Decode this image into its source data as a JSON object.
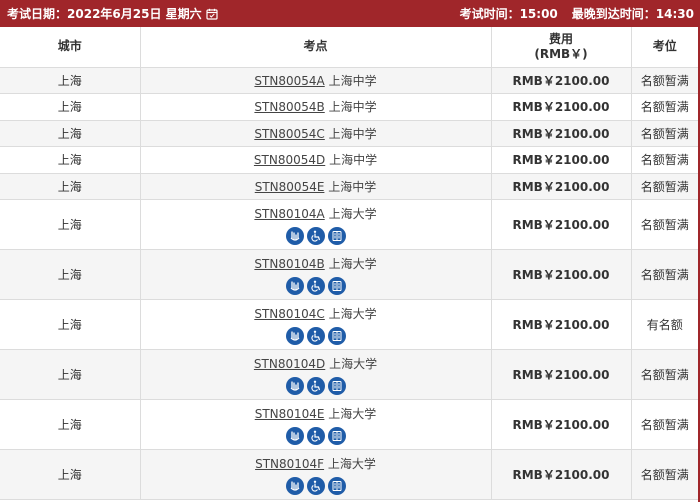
{
  "header": {
    "date_label": "考试日期：",
    "date_value": "2022年6月25日 星期六",
    "time_label": "考试时间：",
    "time_value": "15:00",
    "arrive_label": "最晚到达时间：",
    "arrive_value": "14:30"
  },
  "table": {
    "columns": [
      "城市",
      "考点",
      "费用",
      "(RMB￥)",
      "考位"
    ],
    "rows": [
      {
        "city": "上海",
        "code": "STN80054A",
        "name": "上海中学",
        "fee": "RMB￥2100.00",
        "status": "名额暂满",
        "icons": []
      },
      {
        "city": "上海",
        "code": "STN80054B",
        "name": "上海中学",
        "fee": "RMB￥2100.00",
        "status": "名额暂满",
        "icons": []
      },
      {
        "city": "上海",
        "code": "STN80054C",
        "name": "上海中学",
        "fee": "RMB￥2100.00",
        "status": "名额暂满",
        "icons": []
      },
      {
        "city": "上海",
        "code": "STN80054D",
        "name": "上海中学",
        "fee": "RMB￥2100.00",
        "status": "名额暂满",
        "icons": []
      },
      {
        "city": "上海",
        "code": "STN80054E",
        "name": "上海中学",
        "fee": "RMB￥2100.00",
        "status": "名额暂满",
        "icons": []
      },
      {
        "city": "上海",
        "code": "STN80104A",
        "name": "上海大学",
        "fee": "RMB￥2100.00",
        "status": "名额暂满",
        "icons": [
          "elevator-icon",
          "accessible-icon",
          "restroom-icon"
        ]
      },
      {
        "city": "上海",
        "code": "STN80104B",
        "name": "上海大学",
        "fee": "RMB￥2100.00",
        "status": "名额暂满",
        "icons": [
          "elevator-icon",
          "accessible-icon",
          "restroom-icon"
        ]
      },
      {
        "city": "上海",
        "code": "STN80104C",
        "name": "上海大学",
        "fee": "RMB￥2100.00",
        "status": "有名额",
        "icons": [
          "elevator-icon",
          "accessible-icon",
          "restroom-icon"
        ]
      },
      {
        "city": "上海",
        "code": "STN80104D",
        "name": "上海大学",
        "fee": "RMB￥2100.00",
        "status": "名额暂满",
        "icons": [
          "elevator-icon",
          "accessible-icon",
          "restroom-icon"
        ]
      },
      {
        "city": "上海",
        "code": "STN80104E",
        "name": "上海大学",
        "fee": "RMB￥2100.00",
        "status": "名额暂满",
        "icons": [
          "elevator-icon",
          "accessible-icon",
          "restroom-icon"
        ]
      },
      {
        "city": "上海",
        "code": "STN80104F",
        "name": "上海大学",
        "fee": "RMB￥2100.00",
        "status": "名额暂满",
        "icons": [
          "elevator-icon",
          "accessible-icon",
          "restroom-icon"
        ]
      }
    ]
  },
  "colors": {
    "header_bg": "#a0262a",
    "icon_bg": "#1f5ca8",
    "row_alt": "#f5f5f5"
  }
}
